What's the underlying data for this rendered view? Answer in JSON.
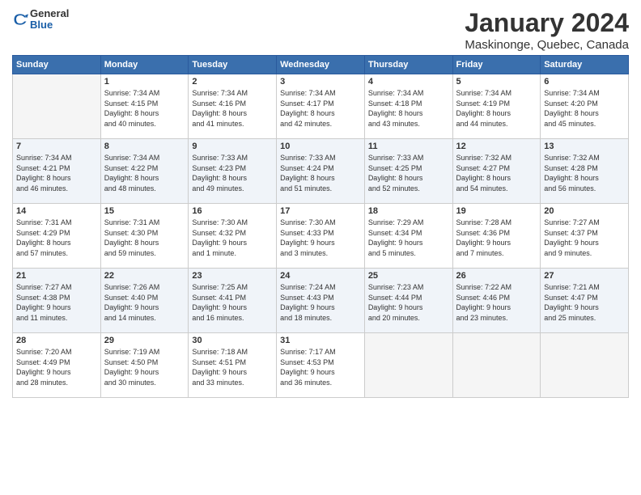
{
  "header": {
    "logo_line1": "General",
    "logo_line2": "Blue",
    "main_title": "January 2024",
    "subtitle": "Maskinonge, Quebec, Canada"
  },
  "weekdays": [
    "Sunday",
    "Monday",
    "Tuesday",
    "Wednesday",
    "Thursday",
    "Friday",
    "Saturday"
  ],
  "weeks": [
    [
      {
        "day": "",
        "info": ""
      },
      {
        "day": "1",
        "info": "Sunrise: 7:34 AM\nSunset: 4:15 PM\nDaylight: 8 hours\nand 40 minutes."
      },
      {
        "day": "2",
        "info": "Sunrise: 7:34 AM\nSunset: 4:16 PM\nDaylight: 8 hours\nand 41 minutes."
      },
      {
        "day": "3",
        "info": "Sunrise: 7:34 AM\nSunset: 4:17 PM\nDaylight: 8 hours\nand 42 minutes."
      },
      {
        "day": "4",
        "info": "Sunrise: 7:34 AM\nSunset: 4:18 PM\nDaylight: 8 hours\nand 43 minutes."
      },
      {
        "day": "5",
        "info": "Sunrise: 7:34 AM\nSunset: 4:19 PM\nDaylight: 8 hours\nand 44 minutes."
      },
      {
        "day": "6",
        "info": "Sunrise: 7:34 AM\nSunset: 4:20 PM\nDaylight: 8 hours\nand 45 minutes."
      }
    ],
    [
      {
        "day": "7",
        "info": "Sunrise: 7:34 AM\nSunset: 4:21 PM\nDaylight: 8 hours\nand 46 minutes."
      },
      {
        "day": "8",
        "info": "Sunrise: 7:34 AM\nSunset: 4:22 PM\nDaylight: 8 hours\nand 48 minutes."
      },
      {
        "day": "9",
        "info": "Sunrise: 7:33 AM\nSunset: 4:23 PM\nDaylight: 8 hours\nand 49 minutes."
      },
      {
        "day": "10",
        "info": "Sunrise: 7:33 AM\nSunset: 4:24 PM\nDaylight: 8 hours\nand 51 minutes."
      },
      {
        "day": "11",
        "info": "Sunrise: 7:33 AM\nSunset: 4:25 PM\nDaylight: 8 hours\nand 52 minutes."
      },
      {
        "day": "12",
        "info": "Sunrise: 7:32 AM\nSunset: 4:27 PM\nDaylight: 8 hours\nand 54 minutes."
      },
      {
        "day": "13",
        "info": "Sunrise: 7:32 AM\nSunset: 4:28 PM\nDaylight: 8 hours\nand 56 minutes."
      }
    ],
    [
      {
        "day": "14",
        "info": "Sunrise: 7:31 AM\nSunset: 4:29 PM\nDaylight: 8 hours\nand 57 minutes."
      },
      {
        "day": "15",
        "info": "Sunrise: 7:31 AM\nSunset: 4:30 PM\nDaylight: 8 hours\nand 59 minutes."
      },
      {
        "day": "16",
        "info": "Sunrise: 7:30 AM\nSunset: 4:32 PM\nDaylight: 9 hours\nand 1 minute."
      },
      {
        "day": "17",
        "info": "Sunrise: 7:30 AM\nSunset: 4:33 PM\nDaylight: 9 hours\nand 3 minutes."
      },
      {
        "day": "18",
        "info": "Sunrise: 7:29 AM\nSunset: 4:34 PM\nDaylight: 9 hours\nand 5 minutes."
      },
      {
        "day": "19",
        "info": "Sunrise: 7:28 AM\nSunset: 4:36 PM\nDaylight: 9 hours\nand 7 minutes."
      },
      {
        "day": "20",
        "info": "Sunrise: 7:27 AM\nSunset: 4:37 PM\nDaylight: 9 hours\nand 9 minutes."
      }
    ],
    [
      {
        "day": "21",
        "info": "Sunrise: 7:27 AM\nSunset: 4:38 PM\nDaylight: 9 hours\nand 11 minutes."
      },
      {
        "day": "22",
        "info": "Sunrise: 7:26 AM\nSunset: 4:40 PM\nDaylight: 9 hours\nand 14 minutes."
      },
      {
        "day": "23",
        "info": "Sunrise: 7:25 AM\nSunset: 4:41 PM\nDaylight: 9 hours\nand 16 minutes."
      },
      {
        "day": "24",
        "info": "Sunrise: 7:24 AM\nSunset: 4:43 PM\nDaylight: 9 hours\nand 18 minutes."
      },
      {
        "day": "25",
        "info": "Sunrise: 7:23 AM\nSunset: 4:44 PM\nDaylight: 9 hours\nand 20 minutes."
      },
      {
        "day": "26",
        "info": "Sunrise: 7:22 AM\nSunset: 4:46 PM\nDaylight: 9 hours\nand 23 minutes."
      },
      {
        "day": "27",
        "info": "Sunrise: 7:21 AM\nSunset: 4:47 PM\nDaylight: 9 hours\nand 25 minutes."
      }
    ],
    [
      {
        "day": "28",
        "info": "Sunrise: 7:20 AM\nSunset: 4:49 PM\nDaylight: 9 hours\nand 28 minutes."
      },
      {
        "day": "29",
        "info": "Sunrise: 7:19 AM\nSunset: 4:50 PM\nDaylight: 9 hours\nand 30 minutes."
      },
      {
        "day": "30",
        "info": "Sunrise: 7:18 AM\nSunset: 4:51 PM\nDaylight: 9 hours\nand 33 minutes."
      },
      {
        "day": "31",
        "info": "Sunrise: 7:17 AM\nSunset: 4:53 PM\nDaylight: 9 hours\nand 36 minutes."
      },
      {
        "day": "",
        "info": ""
      },
      {
        "day": "",
        "info": ""
      },
      {
        "day": "",
        "info": ""
      }
    ]
  ]
}
